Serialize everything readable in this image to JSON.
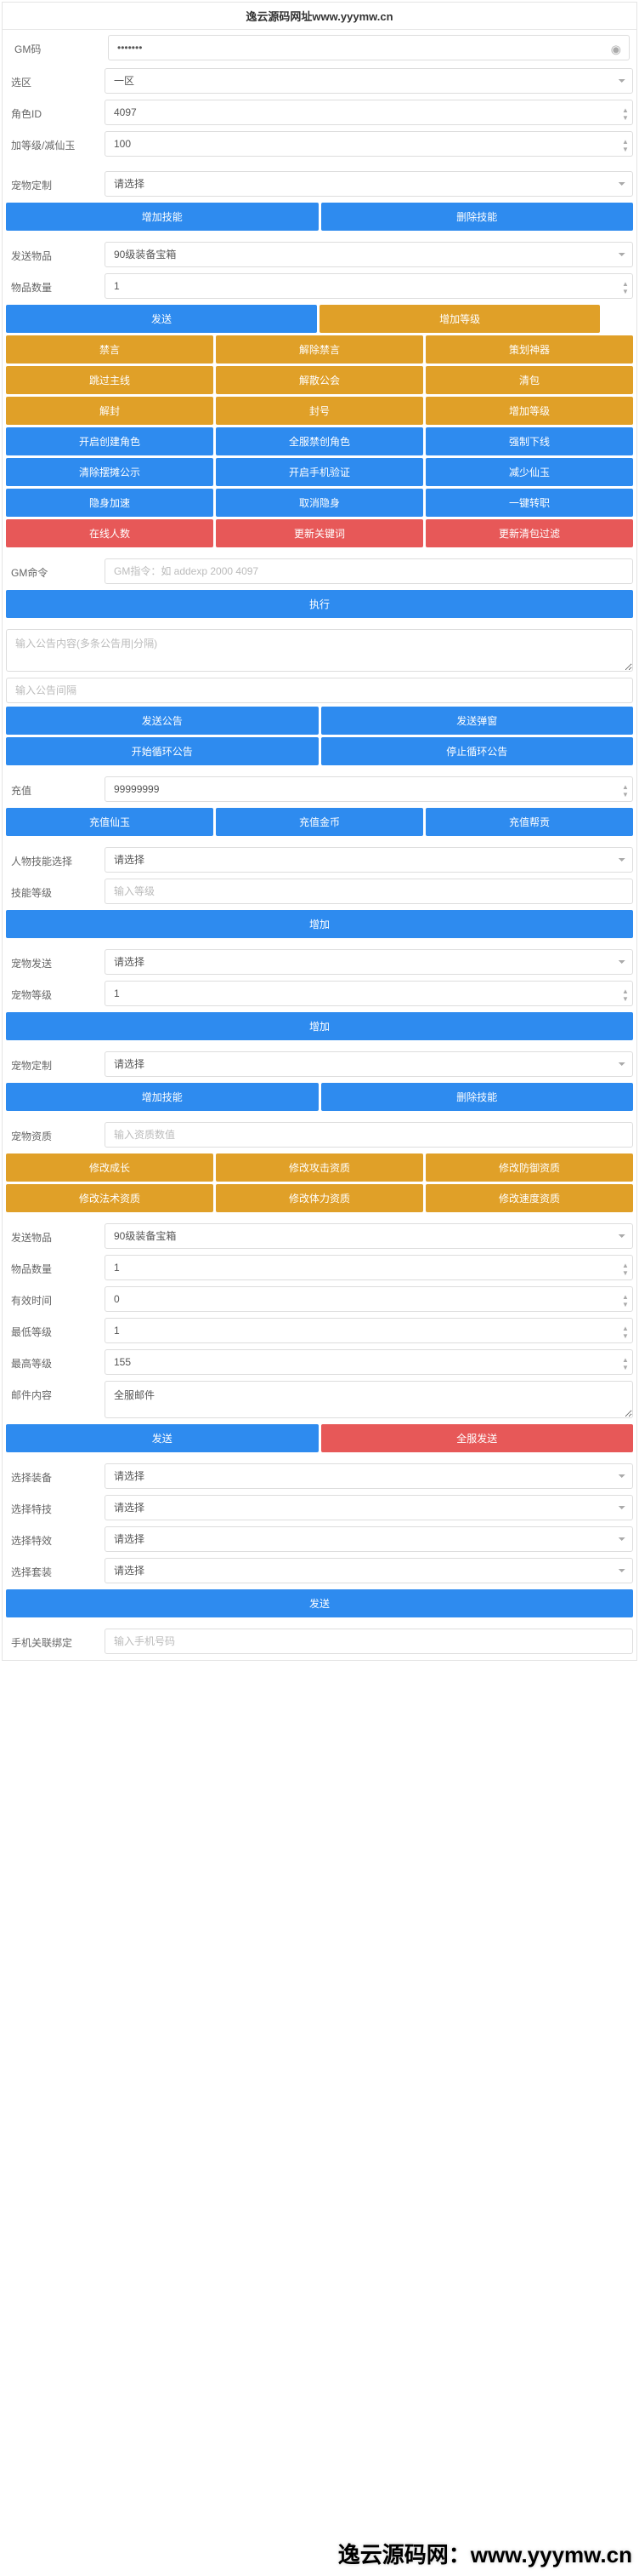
{
  "header": "逸云源码网址www.yyymw.cn",
  "gm_code": {
    "label": "GM码",
    "value": "•••••••"
  },
  "zone": {
    "label": "选区",
    "selected": "一区"
  },
  "role_id": {
    "label": "角色ID",
    "value": "4097"
  },
  "xianyu_amount": {
    "label": "加等级/减仙玉",
    "value": "100"
  },
  "pet_custom1": {
    "label": "宠物定制",
    "placeholder": "请选择"
  },
  "btn_add_skill": "增加技能",
  "btn_del_skill": "删除技能",
  "send_item1": {
    "label": "发送物品",
    "selected": "90级装备宝箱"
  },
  "item_qty1": {
    "label": "物品数量",
    "value": "1"
  },
  "btn_send": "发送",
  "btn_add_level": "增加等级",
  "grid1": [
    [
      "禁言",
      "解除禁言",
      "策划神器"
    ],
    [
      "跳过主线",
      "解散公会",
      "清包"
    ],
    [
      "解封",
      "封号",
      "增加等级"
    ]
  ],
  "grid2": [
    [
      "开启创建角色",
      "全服禁创角色",
      "强制下线"
    ],
    [
      "清除摆摊公示",
      "开启手机验证",
      "减少仙玉"
    ],
    [
      "隐身加速",
      "取消隐身",
      "一键转职"
    ]
  ],
  "grid3": [
    [
      "在线人数",
      "更新关键词",
      "更新清包过滤"
    ]
  ],
  "gm_cmd": {
    "label": "GM命令",
    "placeholder": "GM指令：如 addexp 2000 4097"
  },
  "btn_exec": "执行",
  "notice_content": {
    "placeholder": "输入公告内容(多条公告用|分隔)"
  },
  "notice_interval": {
    "placeholder": "输入公告间隔"
  },
  "btn_send_notice": "发送公告",
  "btn_send_popup": "发送弹窗",
  "btn_start_loop": "开始循环公告",
  "btn_stop_loop": "停止循环公告",
  "recharge": {
    "label": "充值",
    "value": "99999999"
  },
  "btn_recharge_xy": "充值仙玉",
  "btn_recharge_gold": "充值金币",
  "btn_recharge_bg": "充值帮贡",
  "char_skill": {
    "label": "人物技能选择",
    "placeholder": "请选择"
  },
  "skill_level": {
    "label": "技能等级",
    "placeholder": "输入等级"
  },
  "btn_add1": "增加",
  "pet_send": {
    "label": "宠物发送",
    "placeholder": "请选择"
  },
  "pet_level": {
    "label": "宠物等级",
    "value": "1"
  },
  "btn_add2": "增加",
  "pet_custom2": {
    "label": "宠物定制",
    "placeholder": "请选择"
  },
  "btn_add_skill2": "增加技能",
  "btn_del_skill2": "删除技能",
  "pet_quality": {
    "label": "宠物资质",
    "placeholder": "输入资质数值"
  },
  "grid4": [
    [
      "修改成长",
      "修改攻击资质",
      "修改防御资质"
    ],
    [
      "修改法术资质",
      "修改体力资质",
      "修改速度资质"
    ]
  ],
  "send_item2": {
    "label": "发送物品",
    "selected": "90级装备宝箱"
  },
  "item_qty2": {
    "label": "物品数量",
    "value": "1"
  },
  "valid_time": {
    "label": "有效时间",
    "value": "0"
  },
  "min_lvl": {
    "label": "最低等级",
    "value": "1"
  },
  "max_lvl": {
    "label": "最高等级",
    "value": "155"
  },
  "mail_text": {
    "label": "邮件内容",
    "value": "全服邮件"
  },
  "btn_send2": "发送",
  "btn_send_all": "全服发送",
  "sel_equip": {
    "label": "选择装备",
    "placeholder": "请选择"
  },
  "sel_skill": {
    "label": "选择特技",
    "placeholder": "请选择"
  },
  "sel_effect": {
    "label": "选择特效",
    "placeholder": "请选择"
  },
  "sel_set": {
    "label": "选择套装",
    "placeholder": "请选择"
  },
  "btn_send3": "发送",
  "phone_bind": {
    "label": "手机关联绑定",
    "placeholder": "输入手机号码"
  },
  "watermark": "逸云源码网：www.yyymw.cn"
}
